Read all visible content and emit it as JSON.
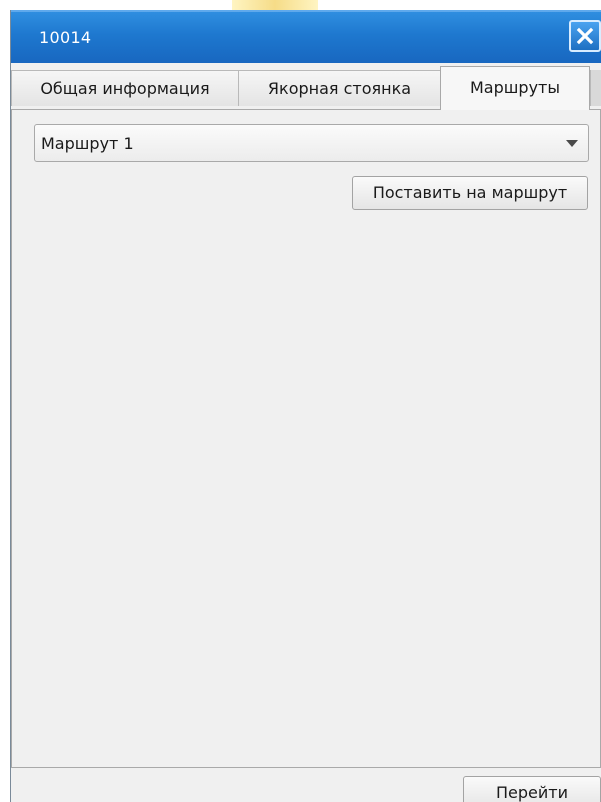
{
  "window": {
    "title": "10014",
    "close_icon": "close-icon"
  },
  "tabs": [
    {
      "label": "Общая информация",
      "active": false
    },
    {
      "label": "Якорная стоянка",
      "active": false
    },
    {
      "label": "Маршруты",
      "active": true
    }
  ],
  "routes_tab": {
    "route_select": {
      "value": "Маршрут 1"
    },
    "assign_button_label": "Поставить на маршрут"
  },
  "footer": {
    "go_button_label": "Перейти"
  },
  "colors": {
    "titlebar": "#1e78cf",
    "window_bg": "#f0f0f0"
  }
}
